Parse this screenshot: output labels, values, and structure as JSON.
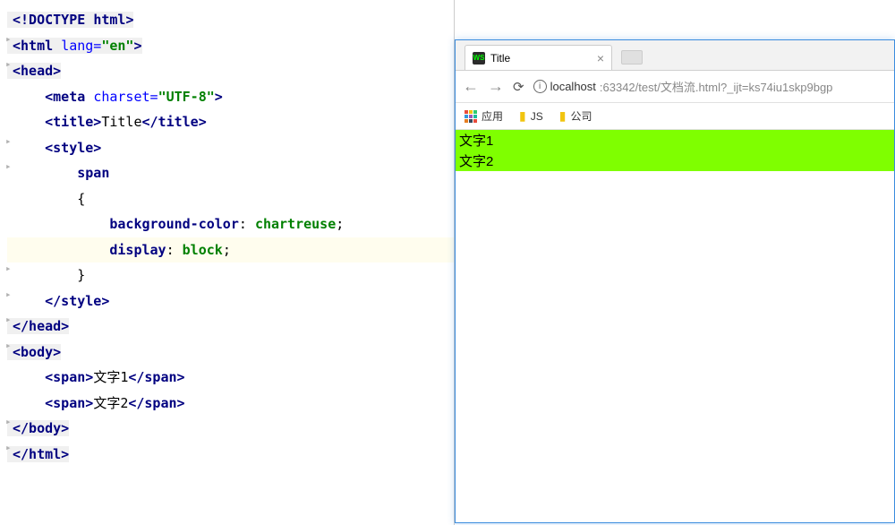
{
  "code": {
    "line1_doctype": "<!DOCTYPE ",
    "line1_html": "html",
    "line1_close": ">",
    "line2_open": "<html ",
    "line2_attr": "lang=",
    "line2_val": "\"en\"",
    "line2_close": ">",
    "line3": "<head>",
    "line4_open": "    <meta ",
    "line4_attr": "charset=",
    "line4_val": "\"UTF-8\"",
    "line4_close": ">",
    "line5_open": "    <title>",
    "line5_text": "Title",
    "line5_close": "</title>",
    "line6": "    <style>",
    "line7": "        span",
    "line8": "        {",
    "line9_prop": "            background-color",
    "line9_colon": ": ",
    "line9_val": "chartreuse",
    "line9_semi": ";",
    "line10_prop": "            display",
    "line10_colon": ": ",
    "line10_val": "block",
    "line10_semi": ";",
    "line11": "        }",
    "line12": "    </style>",
    "line13": "</head>",
    "line14": "<body>",
    "line15_open": "    <span>",
    "line15_text": "文字1",
    "line15_close": "</span>",
    "line16_open": "    <span>",
    "line16_text": "文字2",
    "line16_close": "</span>",
    "line17": "</body>",
    "line18": "</html>"
  },
  "browser": {
    "tab_title": "Title",
    "url_host": "localhost",
    "url_path": ":63342/test/文档流.html?_ijt=ks74iu1skp9bgp",
    "apps_label": "应用",
    "bm1": "JS",
    "bm2": "公司",
    "content_line1": "文字1",
    "content_line2": "文字2"
  }
}
